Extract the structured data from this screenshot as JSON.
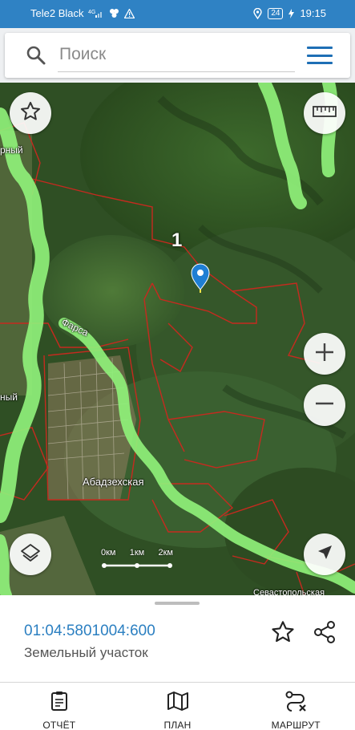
{
  "status_bar": {
    "carrier": "Tele2 Black",
    "network": "4G",
    "battery": "24",
    "time": "19:15"
  },
  "search": {
    "placeholder": "Поиск"
  },
  "map": {
    "pin_label": "1",
    "place_labels": [
      "Абадзехская",
      "Фарса",
      "рный",
      "ный",
      "Севастопольская"
    ],
    "scale_labels": [
      "0км",
      "1км",
      "2км"
    ],
    "colors": {
      "river_highlight": "#8ff07a",
      "parcel_border": "#c62a1f",
      "pin": "#1f7fd4"
    }
  },
  "parcel": {
    "cadastral_number": "01:04:5801004:600",
    "type": "Земельный участок"
  },
  "bottom_nav": {
    "items": [
      {
        "label": "ОТЧЁТ",
        "icon": "report-icon"
      },
      {
        "label": "ПЛАН",
        "icon": "map-plan-icon"
      },
      {
        "label": "МАРШРУТ",
        "icon": "route-icon"
      }
    ]
  }
}
